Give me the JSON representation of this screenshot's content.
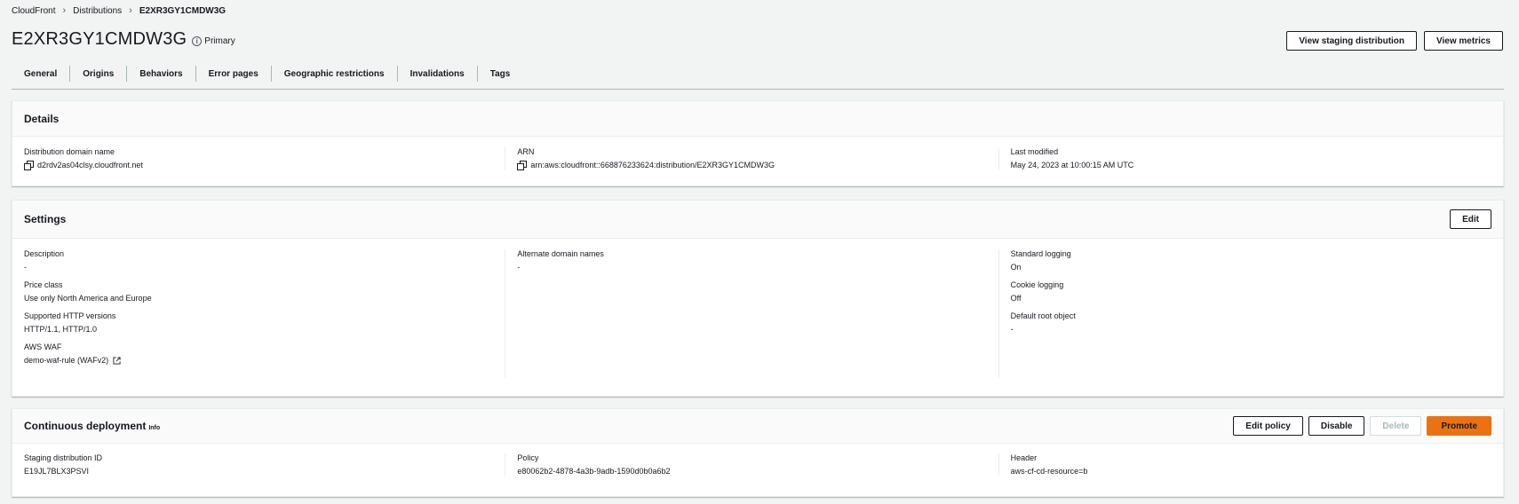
{
  "breadcrumb": {
    "items": [
      "CloudFront",
      "Distributions",
      "E2XR3GY1CMDW3G"
    ]
  },
  "page": {
    "title": "E2XR3GY1CMDW3G",
    "badge": "Primary",
    "actions": {
      "view_staging": "View staging distribution",
      "view_metrics": "View metrics"
    }
  },
  "tabs": [
    "General",
    "Origins",
    "Behaviors",
    "Error pages",
    "Geographic restrictions",
    "Invalidations",
    "Tags"
  ],
  "details": {
    "title": "Details",
    "domain_label": "Distribution domain name",
    "domain_value": "d2rdv2as04clsy.cloudfront.net",
    "arn_label": "ARN",
    "arn_value": "arn:aws:cloudfront::668876233624:distribution/E2XR3GY1CMDW3G",
    "modified_label": "Last modified",
    "modified_value": "May 24, 2023 at 10:00:15 AM UTC"
  },
  "settings": {
    "title": "Settings",
    "edit": "Edit",
    "description_label": "Description",
    "description_value": "-",
    "price_label": "Price class",
    "price_value": "Use only North America and Europe",
    "http_label": "Supported HTTP versions",
    "http_value": "HTTP/1.1, HTTP/1.0",
    "waf_label": "AWS WAF",
    "waf_value": "demo-waf-rule (WAFv2)",
    "alt_label": "Alternate domain names",
    "alt_value": "-",
    "logging_label": "Standard logging",
    "logging_value": "On",
    "cookie_label": "Cookie logging",
    "cookie_value": "Off",
    "root_label": "Default root object",
    "root_value": "-"
  },
  "continuous": {
    "title": "Continuous deployment",
    "info": "Info",
    "edit_policy": "Edit policy",
    "disable": "Disable",
    "delete": "Delete",
    "promote": "Promote",
    "staging_label": "Staging distribution ID",
    "staging_value": "E19JL7BLX3PSVI",
    "policy_label": "Policy",
    "policy_value": "e80062b2-4878-4a3b-9adb-1590d0b0a6b2",
    "header_label": "Header",
    "header_value": "aws-cf-cd-resource=b"
  },
  "colors": {
    "background": "#f2f3f3",
    "primary_button": "#ec7211",
    "text": "#16191f"
  }
}
